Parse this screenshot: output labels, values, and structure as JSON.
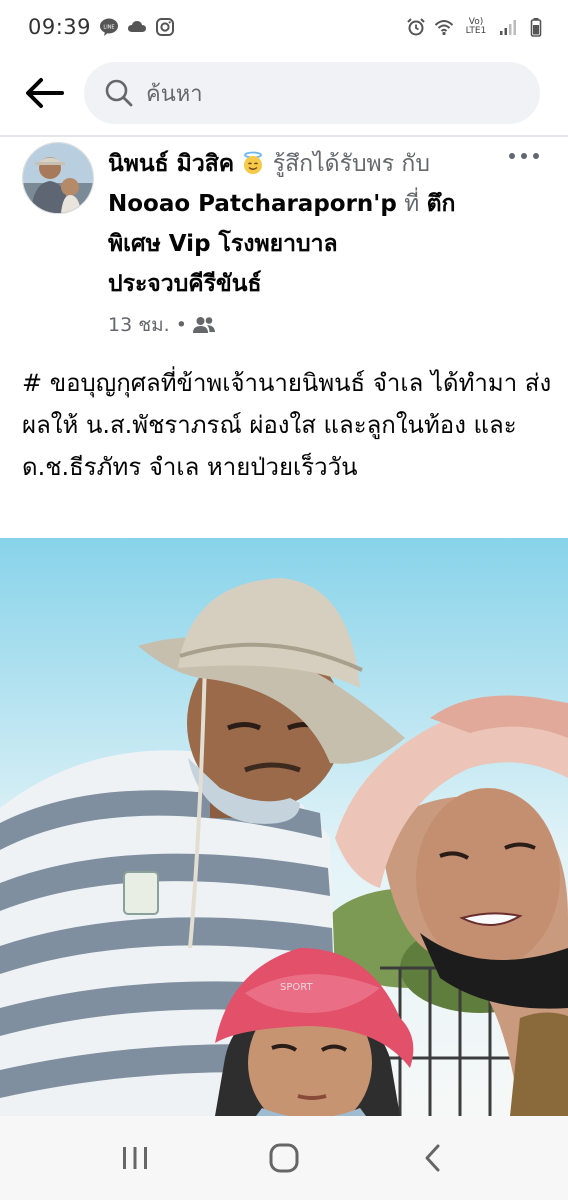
{
  "status_bar": {
    "time": "09:39",
    "network": "Vo) LTE1",
    "icons": [
      "line-icon",
      "cloud-icon",
      "instagram-icon",
      "alarm-icon",
      "wifi-icon",
      "signal-icon",
      "battery-icon"
    ]
  },
  "search": {
    "placeholder": "ค้นหา"
  },
  "post": {
    "author": "นิพนธ์ มิวสิค",
    "feeling": "รู้สึกได้รับพร",
    "with_label": "กับ",
    "tagged": "Nooao Patcharaporn'p",
    "at_label": "ที่",
    "location": "ตึกพิเศษ Vip โรงพยาบาลประจวบคีรีขันธ์",
    "time": "13 ชม.",
    "separator": "•",
    "audience_icon": "friends-icon",
    "text": "# ขอบุญกุศลที่ข้าพเจ้านายนิพนธ์ จำเล ได้ทำมา ส่งผลให้ น.ส.พัชราภรณ์ ผ่องใส และลูกในท้อง   และ ด.ช.ธีรภัทร จำเล หายป่วยเร็ววัน"
  },
  "colors": {
    "text_primary": "#050505",
    "text_secondary": "#65676b",
    "search_bg": "#f0f2f5",
    "nav_bg": "#f7f7f7"
  }
}
